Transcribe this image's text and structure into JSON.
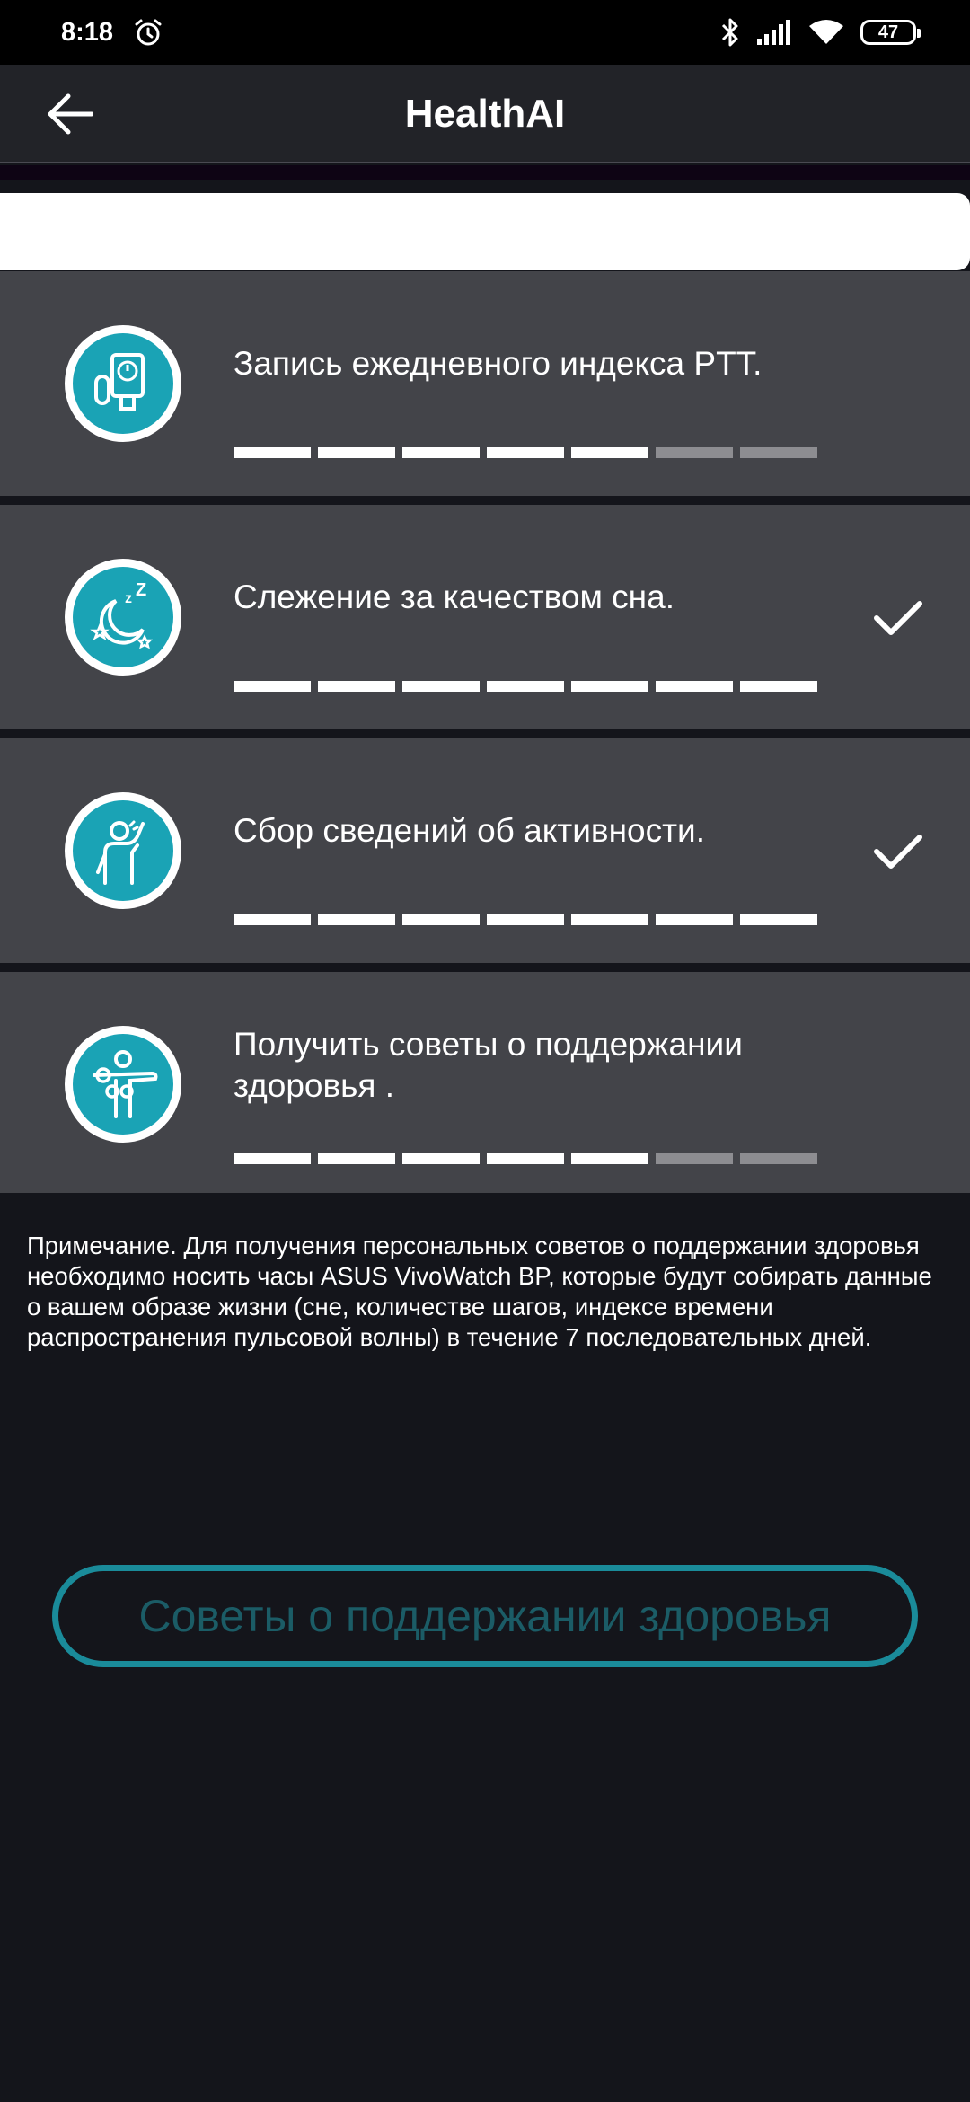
{
  "status_bar": {
    "time": "8:18",
    "battery": "47"
  },
  "header": {
    "title": "HealthAI"
  },
  "cards": [
    {
      "title": "Запись ежедневного индекса PTT.",
      "progress": 5,
      "total": 7,
      "completed": false,
      "icon": "blood-pressure-monitor-icon"
    },
    {
      "title": "Слежение за качеством сна.",
      "progress": 7,
      "total": 7,
      "completed": true,
      "icon": "sleep-moon-icon"
    },
    {
      "title": "Сбор сведений об активности.",
      "progress": 7,
      "total": 7,
      "completed": true,
      "icon": "activity-person-icon"
    },
    {
      "title": "Получить советы о поддержании здоровья .",
      "progress": 5,
      "total": 7,
      "completed": false,
      "icon": "health-advice-person-icon"
    }
  ],
  "note": "Примечание. Для получения персональных советов о поддержании здоровья необходимо носить часы ASUS VivoWatch BP, которые будут собирать данные о вашем образе жизни (сне, количестве шагов, индексе времени распространения пульсовой волны) в течение 7 последовательных дней.",
  "advice_button": {
    "label": "Советы о поддержании здоровья",
    "enabled": false
  },
  "colors": {
    "accent": "#1aa3b5",
    "card_bg": "#434449",
    "page_bg": "#14151b",
    "button_border": "#1a8b9a"
  }
}
